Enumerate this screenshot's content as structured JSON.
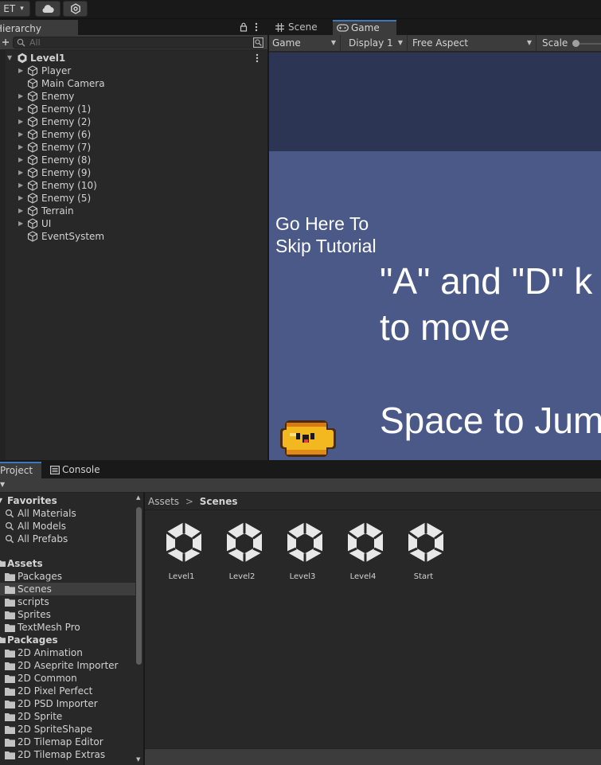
{
  "toolbar": {
    "account_label": "ET",
    "account_caret": "▾"
  },
  "hierarchy": {
    "tab_label": "Hierarchy",
    "search_placeholder": "All",
    "root": "Level1",
    "items": [
      {
        "label": "Player",
        "expandable": true
      },
      {
        "label": "Main Camera",
        "expandable": false
      },
      {
        "label": "Enemy",
        "expandable": true
      },
      {
        "label": "Enemy (1)",
        "expandable": true
      },
      {
        "label": "Enemy (2)",
        "expandable": true
      },
      {
        "label": "Enemy (6)",
        "expandable": true
      },
      {
        "label": "Enemy (7)",
        "expandable": true
      },
      {
        "label": "Enemy (8)",
        "expandable": true
      },
      {
        "label": "Enemy (9)",
        "expandable": true
      },
      {
        "label": "Enemy (10)",
        "expandable": true
      },
      {
        "label": "Enemy (5)",
        "expandable": true
      },
      {
        "label": "Terrain",
        "expandable": true
      },
      {
        "label": "UI",
        "expandable": true
      },
      {
        "label": "EventSystem",
        "expandable": false
      }
    ]
  },
  "game_panel": {
    "tabs": [
      {
        "label": "Scene",
        "icon": "grid-icon",
        "active": false
      },
      {
        "label": "Game",
        "icon": "gamepad-icon",
        "active": true
      }
    ],
    "controls": {
      "mode": "Game",
      "display": "Display 1",
      "aspect": "Free Aspect",
      "scale_label": "Scale"
    },
    "view": {
      "skip_text_line1": "Go Here To",
      "skip_text_line2": "Skip Tutorial",
      "move_line1": "\"A\" and \"D\" k",
      "move_line2": "to move",
      "jump_line": "Space to Jum",
      "sky_color": "#2d3554",
      "ground_color": "#4a5988"
    }
  },
  "project": {
    "tabs": [
      {
        "label": "Project",
        "icon": "folder-icon",
        "active": true
      },
      {
        "label": "Console",
        "icon": "console-icon",
        "active": false
      }
    ],
    "sidebar": {
      "favorites_label": "Favorites",
      "favorites": [
        "All Materials",
        "All Models",
        "All Prefabs"
      ],
      "assets_label": "Assets",
      "assets": [
        "Packages",
        "Scenes",
        "scripts",
        "Sprites",
        "TextMesh Pro"
      ],
      "selected_asset": "Scenes",
      "packages_label": "Packages",
      "packages": [
        "2D Animation",
        "2D Aseprite Importer",
        "2D Common",
        "2D Pixel Perfect",
        "2D PSD Importer",
        "2D Sprite",
        "2D SpriteShape",
        "2D Tilemap Editor",
        "2D Tilemap Extras"
      ]
    },
    "breadcrumb": {
      "root": "Assets",
      "separator": ">",
      "current": "Scenes"
    },
    "scenes": [
      "Level1",
      "Level2",
      "Level3",
      "Level4",
      "Start"
    ]
  }
}
